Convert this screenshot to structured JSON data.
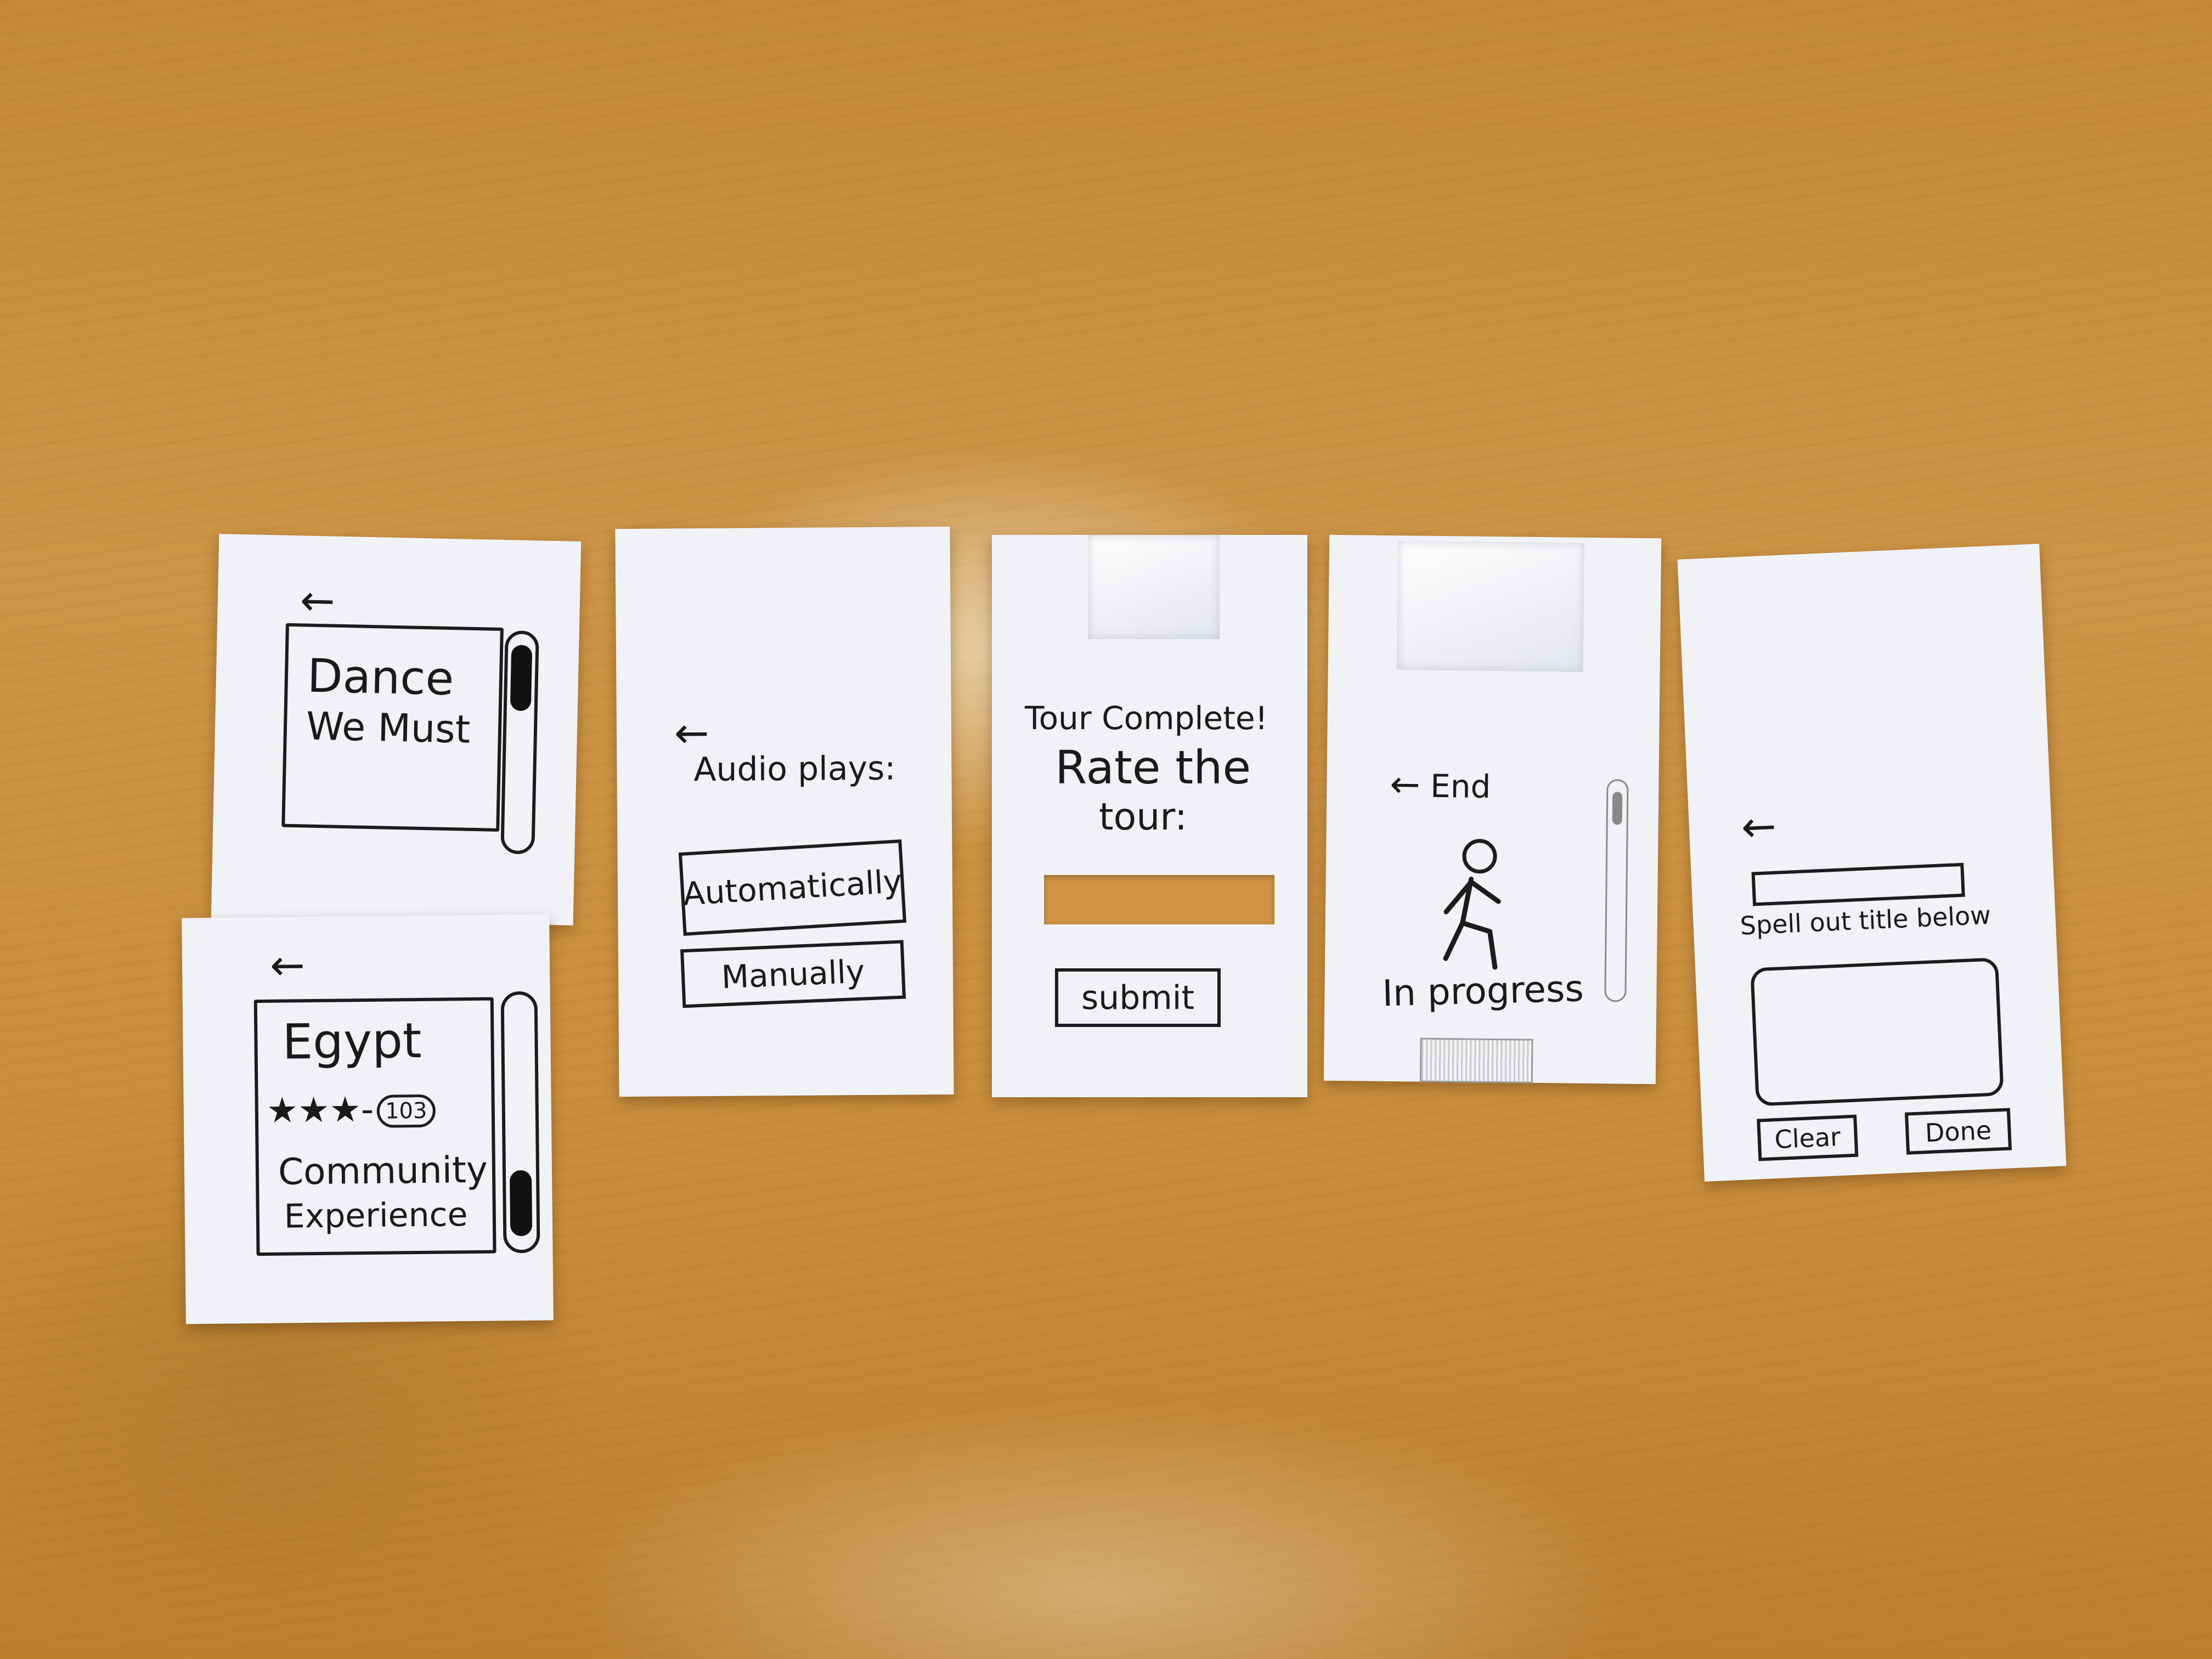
{
  "screens": {
    "tour_list": {
      "back_glyph": "←",
      "dance": {
        "title_line1": "Dance",
        "title_line2": "We Must"
      },
      "egypt": {
        "title": "Egypt",
        "stars": "★★★",
        "dash": "-",
        "rating_count": "103",
        "subtitle_line1": "Community",
        "subtitle_line2": "Experience"
      }
    },
    "audio_settings": {
      "back_glyph": "←",
      "heading": "Audio plays:",
      "option_auto": "Automatically",
      "option_manual": "Manually"
    },
    "tour_complete": {
      "heading": "Tour Complete!",
      "prompt_line1": "Rate the",
      "prompt_line2": "tour:",
      "submit_label": "submit"
    },
    "in_progress": {
      "back_glyph": "←",
      "end_label": "End",
      "status": "In progress",
      "walker_icon": "person-walking-icon"
    },
    "spell_title": {
      "back_glyph": "←",
      "instruction": "Spell out title below",
      "clear_label": "Clear",
      "done_label": "Done"
    }
  },
  "colors": {
    "ink": "#1a1a1a",
    "paper": "#f1f2f6",
    "table": "#c98d3c"
  }
}
